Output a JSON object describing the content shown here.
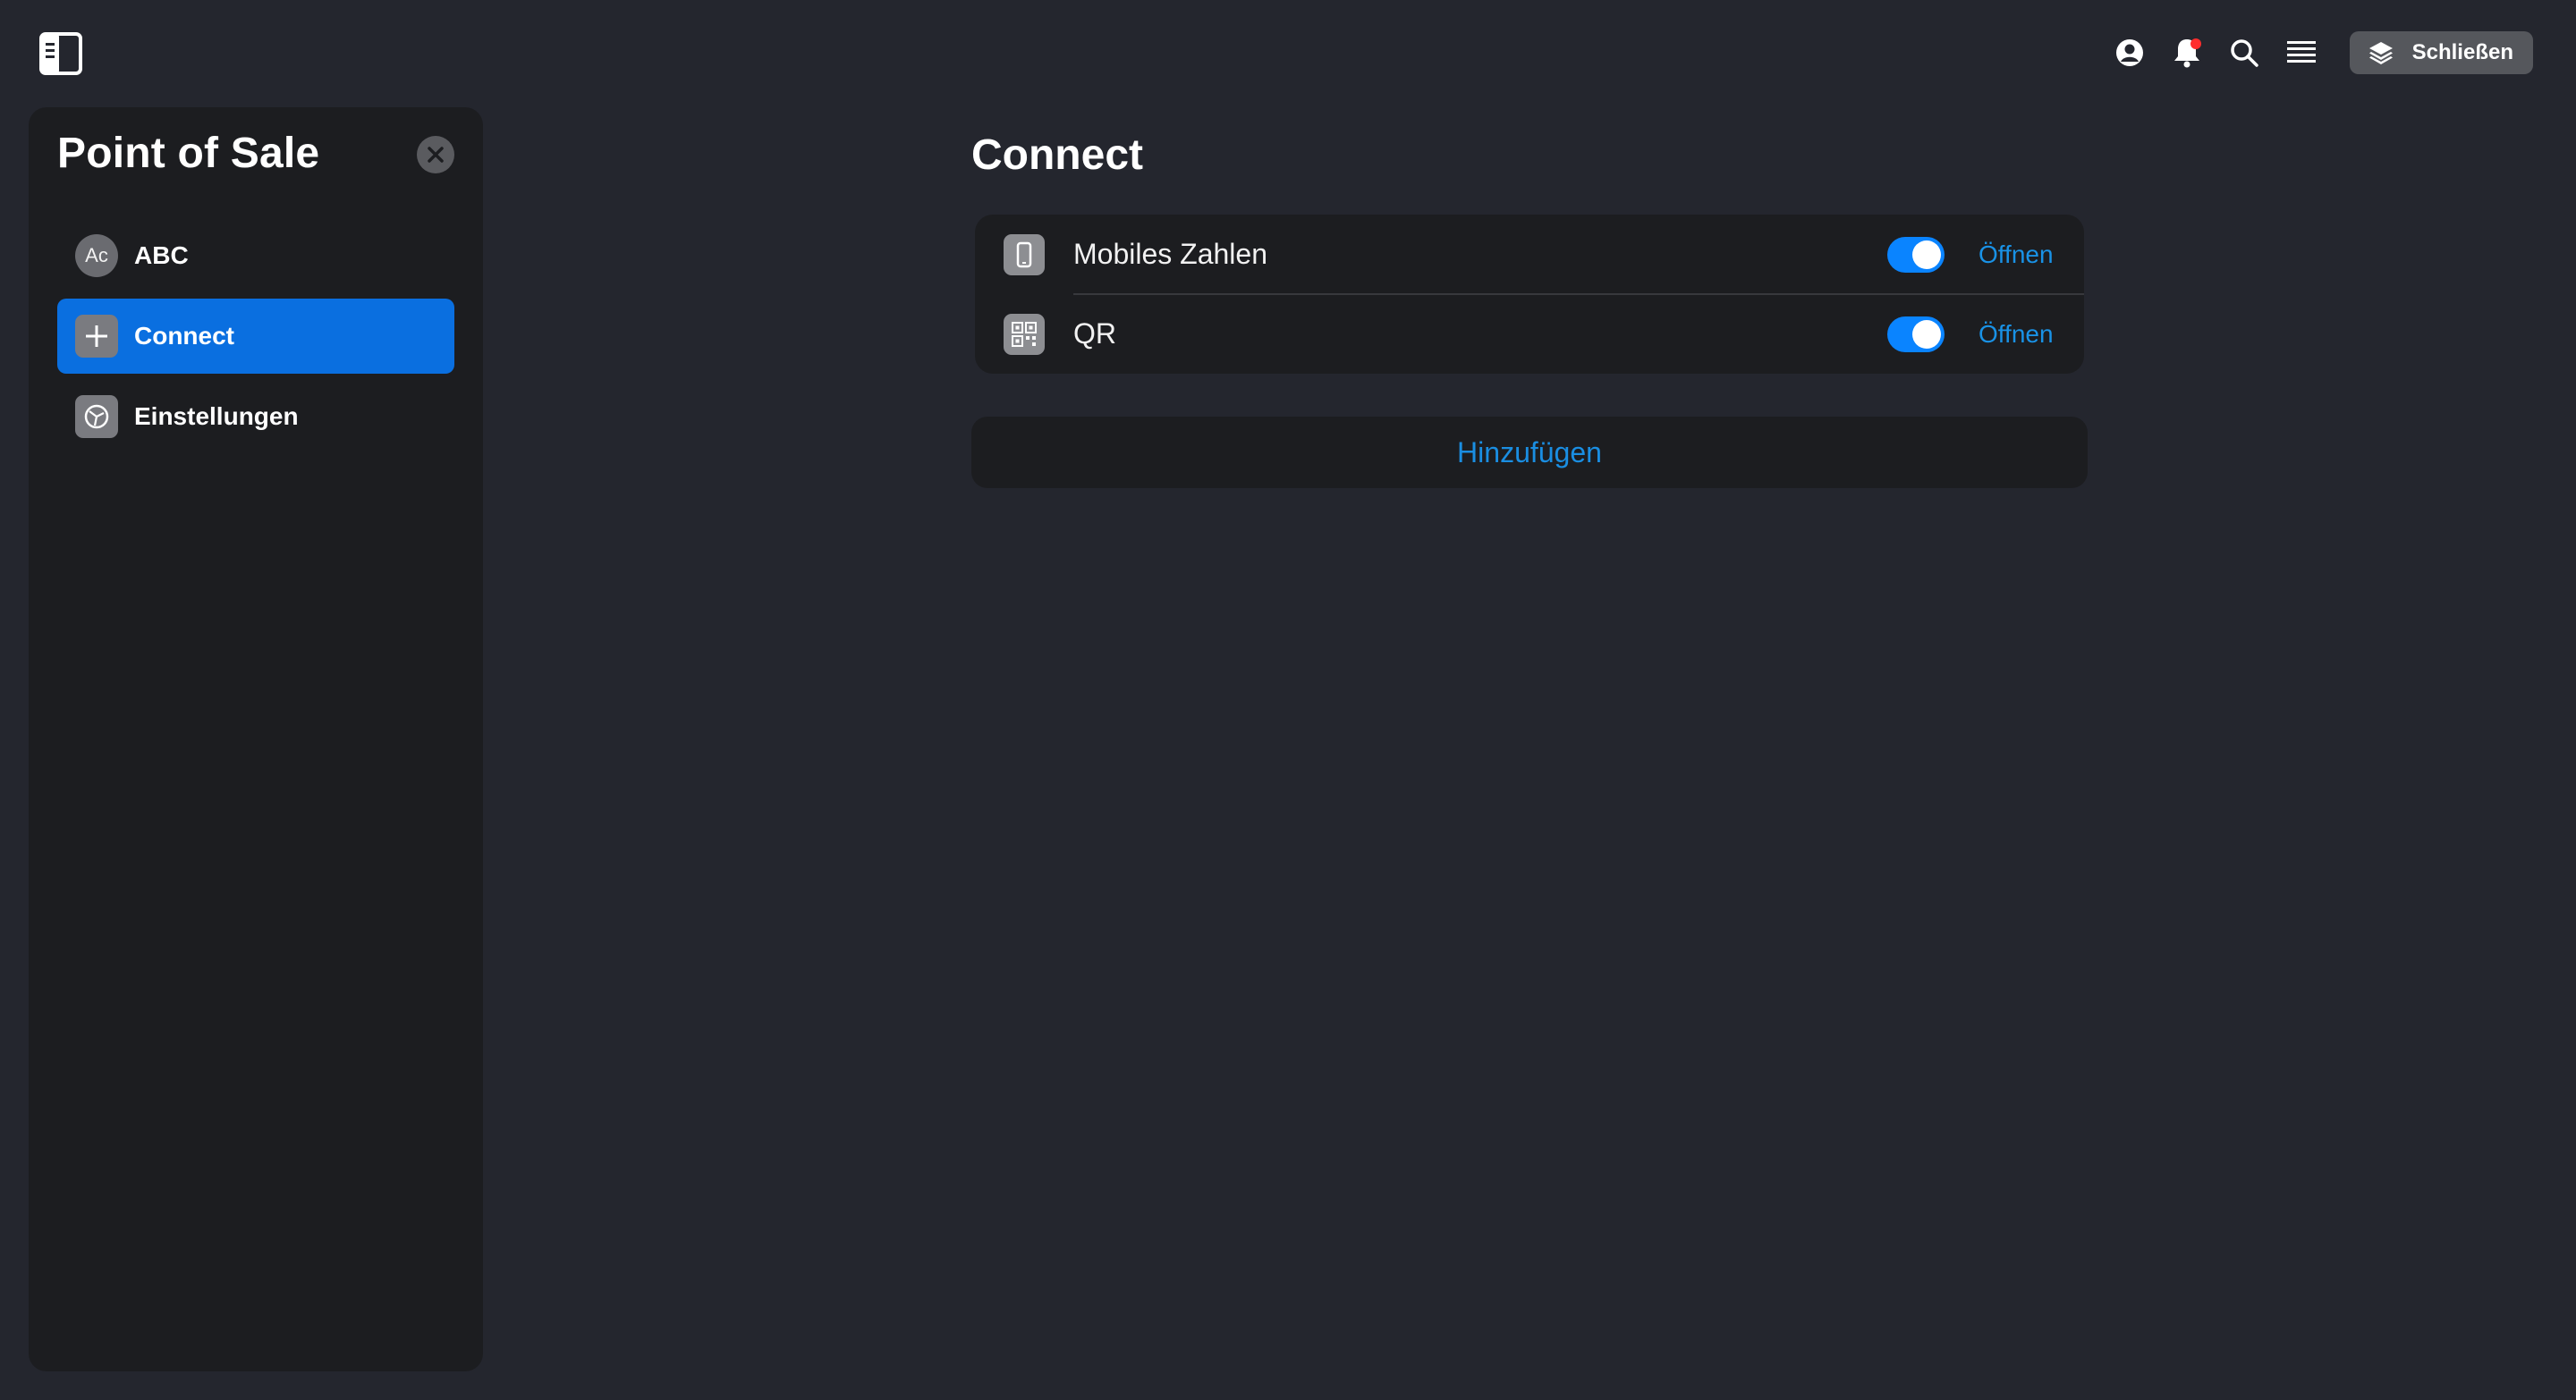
{
  "topbar": {
    "icons": [
      "sidebar-toggle-icon",
      "user-circle-icon",
      "bell-icon",
      "search-icon",
      "menu-lines-icon"
    ],
    "close_button": {
      "label": "Schließen",
      "icon": "layers-icon"
    },
    "notification_color": "#ff2d2d"
  },
  "sidebar": {
    "title": "Point of Sale",
    "items": [
      {
        "label": "ABC",
        "avatar_text": "Ac",
        "active": false
      },
      {
        "label": "Connect",
        "icon": "plus-icon",
        "active": true
      },
      {
        "label": "Einstellungen",
        "icon": "settings-dial-icon",
        "active": false
      }
    ]
  },
  "main": {
    "title": "Connect",
    "rows": [
      {
        "label": "Mobiles Zahlen",
        "icon": "phone-icon",
        "enabled": true,
        "action": "Öffnen"
      },
      {
        "label": "QR",
        "icon": "qr-code-icon",
        "enabled": true,
        "action": "Öffnen"
      }
    ],
    "add_label": "Hinzufügen"
  },
  "colors": {
    "background": "#24262e",
    "panel": "#1c1d20",
    "accent": "#0a6fe0",
    "link": "#1992e6",
    "toggle_on": "#0a84ff"
  }
}
